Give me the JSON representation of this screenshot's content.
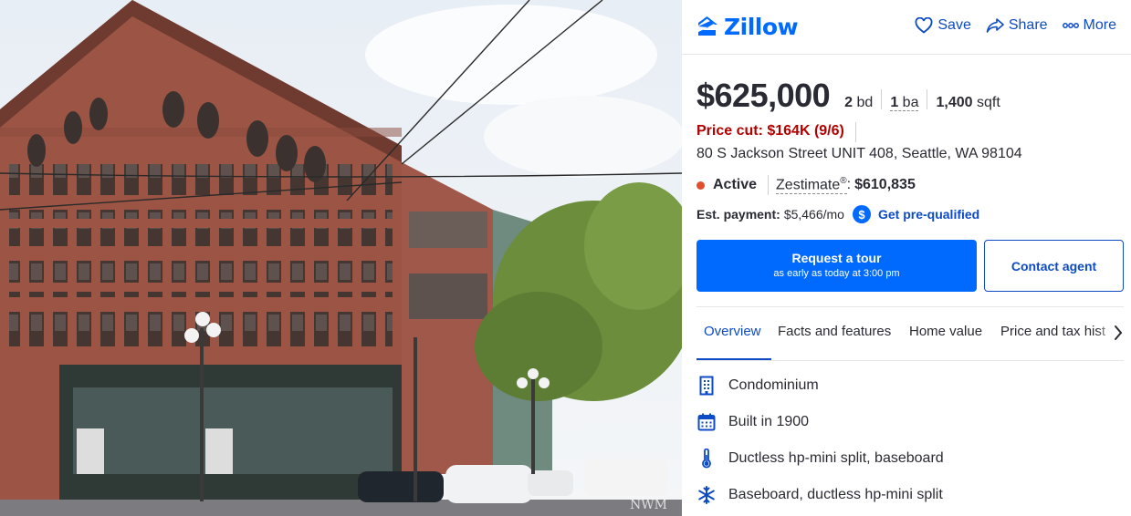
{
  "brand": {
    "name": "Zillow",
    "color": "#006aff"
  },
  "header_actions": [
    {
      "label": "Save",
      "icon": "heart-icon"
    },
    {
      "label": "Share",
      "icon": "share-icon"
    },
    {
      "label": "More",
      "icon": "more-icon"
    }
  ],
  "listing": {
    "price": "$625,000",
    "beds_num": "2",
    "beds_unit": "bd",
    "baths_num": "1",
    "baths_unit": "ba",
    "sqft_num": "1,400",
    "sqft_unit": "sqft",
    "price_cut": "Price cut: $164K (9/6)",
    "address": "80 S Jackson Street UNIT 408, Seattle, WA 98104",
    "status": "Active",
    "zestimate_label": "Zestimate",
    "zestimate_reg": "®",
    "zestimate_colon": ":",
    "zestimate_value": "$610,835",
    "est_payment_label": "Est. payment:",
    "est_payment_value": "$5,466/mo",
    "prequal_label": "Get pre-qualified"
  },
  "colors": {
    "status_dot": "#e04e2c",
    "price_cut": "#b30000",
    "link": "#0d4bc6"
  },
  "cta": {
    "tour_title": "Request a tour",
    "tour_subtitle": "as early as today at 3:00 pm",
    "contact": "Contact agent"
  },
  "tabs": [
    {
      "label": "Overview",
      "active": true
    },
    {
      "label": "Facts and features",
      "active": false
    },
    {
      "label": "Home value",
      "active": false
    },
    {
      "label": "Price and tax hist",
      "active": false
    }
  ],
  "features": [
    {
      "icon": "building-icon",
      "text": "Condominium"
    },
    {
      "icon": "calendar-icon",
      "text": "Built in 1900"
    },
    {
      "icon": "thermometer-icon",
      "text": "Ductless hp-mini split, baseboard"
    },
    {
      "icon": "snowflake-icon",
      "text": "Baseboard, ductless hp-mini split"
    }
  ],
  "photo": {
    "watermark": "NWM"
  }
}
